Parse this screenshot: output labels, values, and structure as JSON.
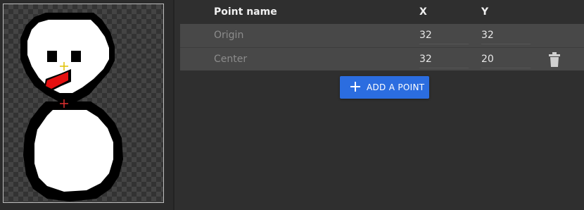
{
  "table": {
    "headers": {
      "name": "Point name",
      "x": "X",
      "y": "Y"
    },
    "rows": [
      {
        "name": "Origin",
        "x": "32",
        "y": "32",
        "deletable": false
      },
      {
        "name": "Center",
        "x": "32",
        "y": "20",
        "deletable": true
      }
    ]
  },
  "actions": {
    "add_point_label": "ADD A POINT"
  },
  "icons": {
    "delete": "trash-icon",
    "add": "plus-icon",
    "origin_marker": "crosshair-icon",
    "center_marker": "crosshair-icon"
  },
  "colors": {
    "accent": "#2b6de0",
    "panel": "#2f2f2f",
    "row": "#484848",
    "origin_marker": "#e0c000",
    "center_marker": "#e03030"
  }
}
